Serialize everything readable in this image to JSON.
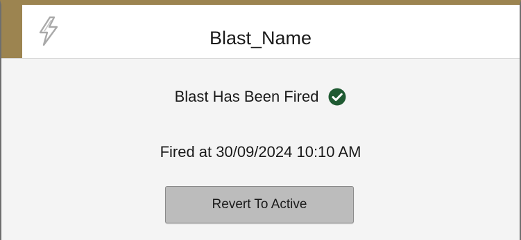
{
  "header": {
    "title": "Blast_Name",
    "icon": "lightning-bolt-icon",
    "accent_color": "#9c8450"
  },
  "status": {
    "text": "Blast Has Been Fired",
    "icon": "check-circle-icon",
    "icon_color": "#1f5a32"
  },
  "fired": {
    "text": "Fired at 30/09/2024 10:10 AM"
  },
  "actions": {
    "revert_label": "Revert To Active"
  }
}
